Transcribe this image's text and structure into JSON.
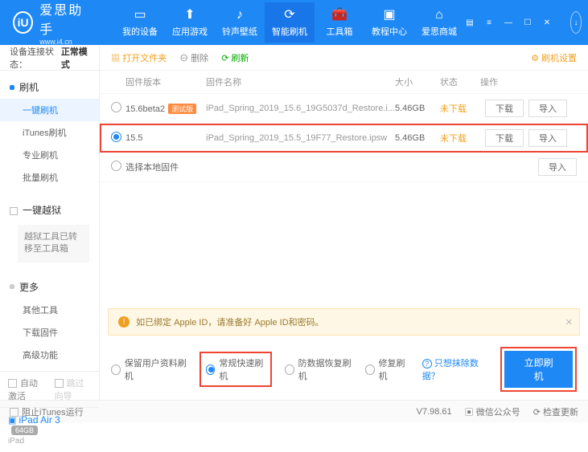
{
  "brand": {
    "name": "爱思助手",
    "url": "www.i4.cn",
    "logo": "iU"
  },
  "nav": [
    {
      "icon": "▭",
      "label": "我的设备"
    },
    {
      "icon": "⬆",
      "label": "应用游戏"
    },
    {
      "icon": "♪",
      "label": "铃声壁纸"
    },
    {
      "icon": "⟳",
      "label": "智能刷机"
    },
    {
      "icon": "🧰",
      "label": "工具箱"
    },
    {
      "icon": "▣",
      "label": "教程中心"
    },
    {
      "icon": "⌂",
      "label": "爱思商城"
    }
  ],
  "sidebar": {
    "status_label": "设备连接状态：",
    "status_value": "正常模式",
    "g1": "刷机",
    "items1": [
      "一键刷机",
      "iTunes刷机",
      "专业刷机",
      "批量刷机"
    ],
    "g2": "一键越狱",
    "note": "越狱工具已转移至工具箱",
    "g3": "更多",
    "items3": [
      "其他工具",
      "下载固件",
      "高级功能"
    ],
    "auto": "自动激活",
    "skip": "跳过向导",
    "device": {
      "name": "iPad Air 3",
      "storage": "64GB",
      "model": "iPad"
    }
  },
  "toolbar": {
    "open": "打开文件夹",
    "del": "删除",
    "refresh": "刷新",
    "settings": "刷机设置"
  },
  "thead": {
    "ver": "固件版本",
    "name": "固件名称",
    "size": "大小",
    "state": "状态",
    "op": "操作"
  },
  "rows": [
    {
      "sel": false,
      "ver": "15.6beta2",
      "tag": "测试版",
      "name": "iPad_Spring_2019_15.6_19G5037d_Restore.i...",
      "size": "5.46GB",
      "state": "未下载",
      "ops": [
        "下载",
        "导入"
      ]
    },
    {
      "sel": true,
      "ver": "15.5",
      "tag": "",
      "name": "iPad_Spring_2019_15.5_19F77_Restore.ipsw",
      "size": "5.46GB",
      "state": "未下载",
      "ops": [
        "下载",
        "导入"
      ]
    }
  ],
  "local_row": {
    "label": "选择本地固件",
    "op": "导入"
  },
  "notice": "如已绑定 Apple ID，请准备好 Apple ID和密码。",
  "opts": [
    "保留用户资料刷机",
    "常规快速刷机",
    "防数据恢复刷机",
    "修复刷机"
  ],
  "erase_link": "只想抹除数据？",
  "flash_btn": "立即刷机",
  "footer": {
    "block": "阻止iTunes运行",
    "ver": "V7.98.61",
    "wx": "微信公众号",
    "check": "检查更新"
  }
}
